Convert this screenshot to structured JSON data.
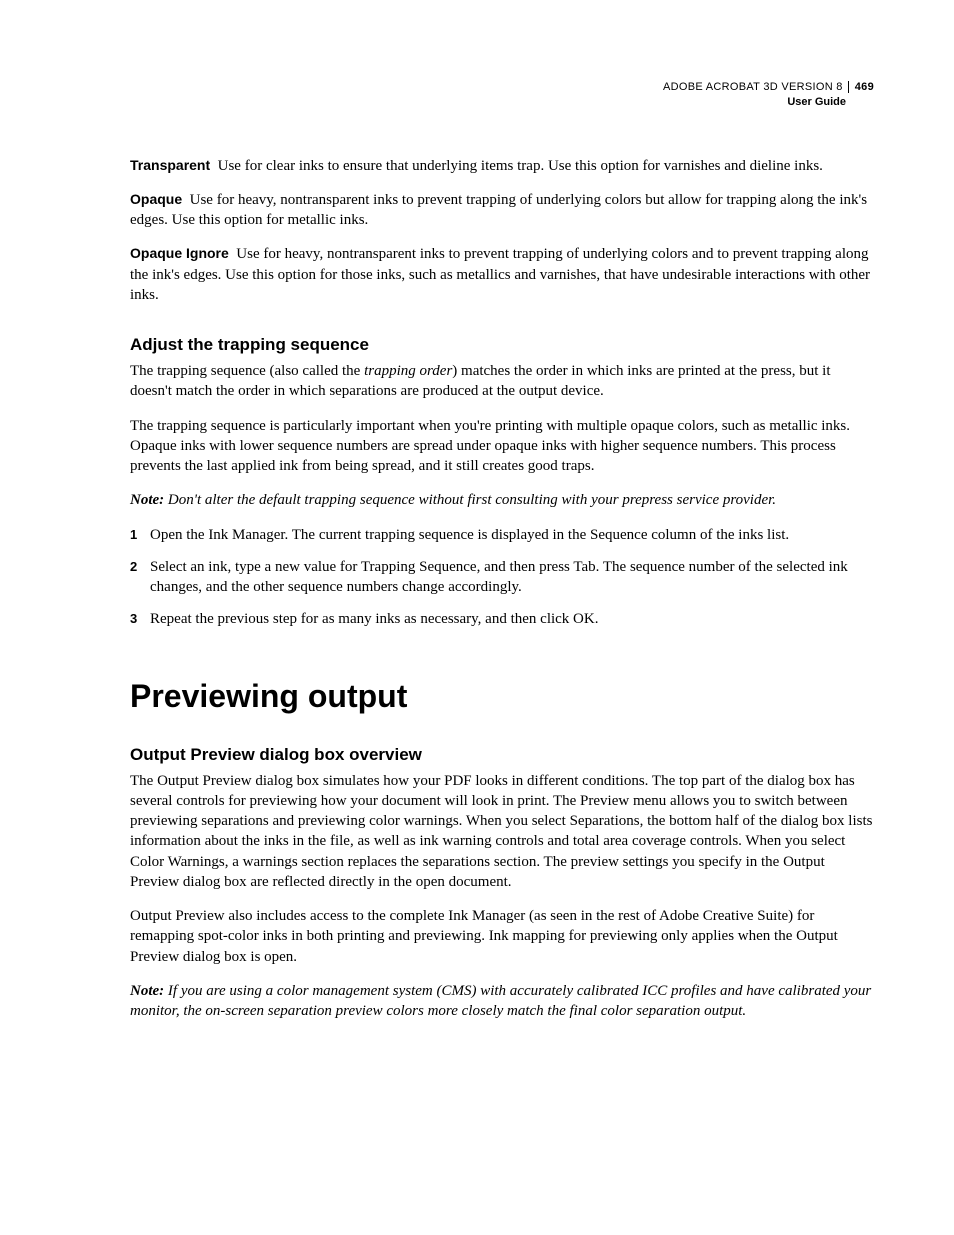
{
  "header": {
    "product": "ADOBE ACROBAT 3D VERSION 8",
    "page_number": "469",
    "doc_type": "User Guide"
  },
  "defs": {
    "transparent": {
      "term": "Transparent",
      "text": "Use for clear inks to ensure that underlying items trap. Use this option for varnishes and dieline inks."
    },
    "opaque": {
      "term": "Opaque",
      "text": "Use for heavy, nontransparent inks to prevent trapping of underlying colors but allow for trapping along the ink's edges. Use this option for metallic inks."
    },
    "opaque_ignore": {
      "term": "Opaque Ignore",
      "text": "Use for heavy, nontransparent inks to prevent trapping of underlying colors and to prevent trapping along the ink's edges. Use this option for those inks, such as metallics and varnishes, that have undesirable interac­tions with other inks."
    }
  },
  "section1": {
    "heading": "Adjust the trapping sequence",
    "p1a": "The trapping sequence (also called the ",
    "p1_em": "trapping order",
    "p1b": ") matches the order in which inks are printed at the press, but it doesn't match the order in which separations are produced at the output device.",
    "p2": "The trapping sequence is particularly important when you're printing with multiple opaque colors, such as metallic inks. Opaque inks with lower sequence numbers are spread under opaque inks with higher sequence numbers. This process prevents the last applied ink from being spread, and it still creates good traps.",
    "note_label": "Note:",
    "note_text": " Don't alter the default trapping sequence without first consulting with your prepress service provider.",
    "steps": {
      "n1": "1",
      "s1": "Open the Ink Manager. The current trapping sequence is displayed in the Sequence column of the inks list.",
      "n2": "2",
      "s2": "Select an ink, type a new value for Trapping Sequence, and then press Tab. The sequence number of the selected ink changes, and the other sequence numbers change accordingly.",
      "n3": "3",
      "s3": "Repeat the previous step for as many inks as necessary, and then click OK."
    }
  },
  "chapter": {
    "title": "Previewing output"
  },
  "section2": {
    "heading": "Output Preview dialog box overview",
    "p1": "The Output Preview dialog box simulates how your PDF looks in different conditions. The top part of the dialog box has several controls for previewing how your document will look in print. The Preview menu allows you to switch between previewing separations and previewing color warnings. When you select Separations, the bottom half of the dialog box lists information about the inks in the file, as well as ink warning controls and total area coverage controls. When you select Color Warnings, a warnings section replaces the separations section. The preview settings you specify in the Output Preview dialog box are reflected directly in the open document.",
    "p2": "Output Preview also includes access to the complete Ink Manager (as seen in the rest of Adobe Creative Suite) for remapping spot-color inks in both printing and previewing. Ink mapping for previewing only applies when the Output Preview dialog box is open.",
    "note_label": "Note:",
    "note_text": " If you are using a color management system (CMS) with accurately calibrated ICC profiles and have calibrated your monitor, the on-screen separation preview colors more closely match the final color separation output."
  }
}
